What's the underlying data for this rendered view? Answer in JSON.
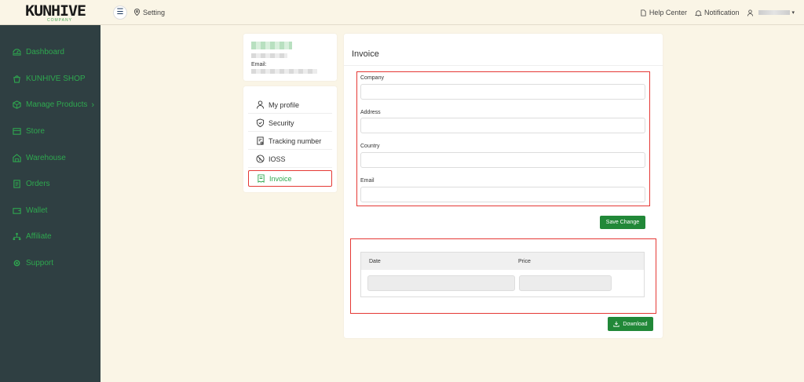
{
  "brand": {
    "logo": "KUNHIVE",
    "tagline": "COMPANY"
  },
  "sidebar": {
    "items": [
      {
        "label": "Dashboard",
        "icon": "dashboard-icon"
      },
      {
        "label": "KUNHIVE SHOP",
        "icon": "shop-icon"
      },
      {
        "label": "Manage Products",
        "icon": "products-icon",
        "chevron": "›"
      },
      {
        "label": "Store",
        "icon": "store-icon"
      },
      {
        "label": "Warehouse",
        "icon": "warehouse-icon"
      },
      {
        "label": "Orders",
        "icon": "orders-icon"
      },
      {
        "label": "Wallet",
        "icon": "wallet-icon"
      },
      {
        "label": "Affiliate",
        "icon": "affiliate-icon"
      },
      {
        "label": "Support",
        "icon": "support-icon"
      }
    ]
  },
  "header": {
    "menu_glyph": "☰",
    "breadcrumb": "Setting",
    "help": "Help Center",
    "notification": "Notification",
    "caret": "▾"
  },
  "profile": {
    "email_label": "Email:"
  },
  "settings_menu": {
    "items": [
      {
        "label": "My profile"
      },
      {
        "label": "Security"
      },
      {
        "label": "Tracking number"
      },
      {
        "label": "IOSS"
      },
      {
        "label": "Invoice"
      }
    ],
    "active": "Invoice"
  },
  "invoice": {
    "title": "Invoice",
    "fields": [
      {
        "label": "Company",
        "value": ""
      },
      {
        "label": "Address",
        "value": ""
      },
      {
        "label": "Country",
        "value": ""
      },
      {
        "label": "Email",
        "value": ""
      }
    ],
    "save_label": "Save Change",
    "table": {
      "columns": [
        "Date",
        "Price"
      ]
    },
    "download_label": "Download"
  },
  "colors": {
    "sidebar_bg": "#2f3f42",
    "accent_green": "#2fa84f",
    "button_green": "#218838",
    "highlight_red": "#e53935",
    "page_bg": "#faf5e6"
  }
}
